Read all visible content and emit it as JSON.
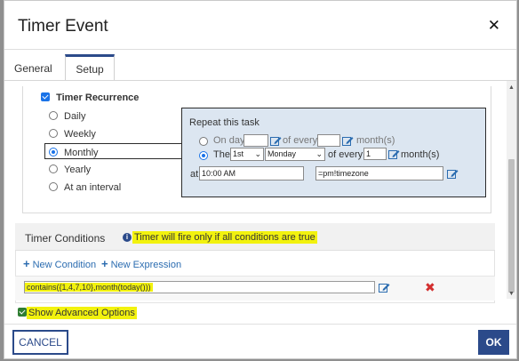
{
  "dialog": {
    "title": "Timer Event"
  },
  "tabs": [
    {
      "label": "General"
    },
    {
      "label": "Setup"
    }
  ],
  "recurrence": {
    "label": "Timer Recurrence",
    "options": [
      "Daily",
      "Weekly",
      "Monthly",
      "Yearly",
      "At an interval"
    ],
    "selected": "Monthly"
  },
  "repeat": {
    "title": "Repeat this task",
    "on_day_label": "On day",
    "of_every_label": "of every",
    "months_label": "month(s)",
    "the_label": "The",
    "ordinal_value": "1st",
    "weekday_value": "Monday",
    "of_every_label2": "of every",
    "every_value": "1",
    "months_label2": "month(s)",
    "at_label": "at",
    "time_value": "10:00 AM",
    "timezone_value": "=pm!timezone"
  },
  "conditions": {
    "title": "Timer Conditions",
    "note": "Timer will fire only if all conditions are true",
    "new_condition": "New Condition",
    "new_expression": "New Expression",
    "expression": "contains({1,4,7,10},month(today()))"
  },
  "advanced": {
    "label": "Show Advanced Options"
  },
  "buttons": {
    "cancel": "CANCEL",
    "ok": "OK"
  },
  "colors": {
    "accent": "#2b4a8a",
    "highlight": "#f2f20e",
    "panel": "#dce6f1",
    "delete": "#d32f2f"
  }
}
